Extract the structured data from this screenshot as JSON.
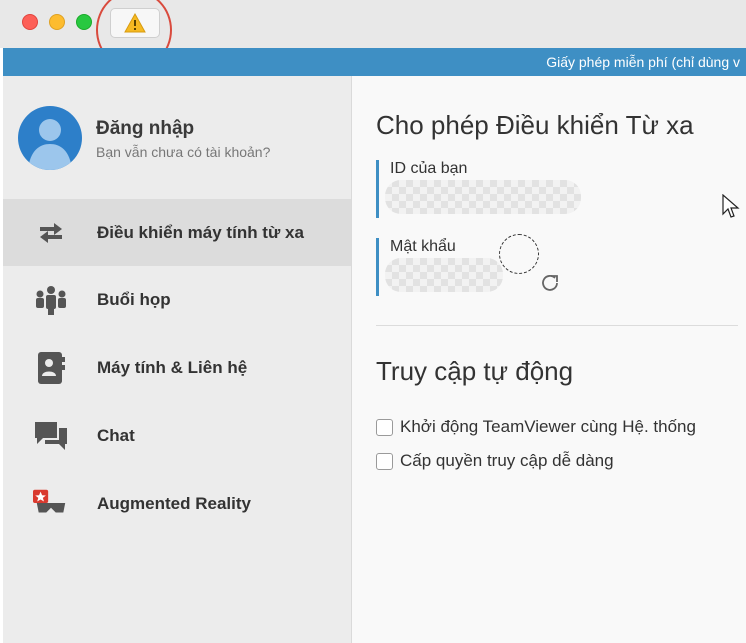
{
  "window": {
    "controls": [
      "close",
      "minimize",
      "zoom"
    ],
    "toolbar_icon": "warning-icon",
    "annotation_color": "#d94a3d"
  },
  "banner": {
    "text": "Giấy phép miễn phí (chỉ dùng v",
    "color": "#3e8fc4"
  },
  "account": {
    "name": "Đăng nhập",
    "subtitle": "Bạn vẫn chưa có tài khoản?",
    "icon": "user-avatar-icon"
  },
  "sidebar": {
    "items": [
      {
        "label": "Điều khiển máy tính từ xa",
        "icon": "remote-arrows-icon",
        "active": true
      },
      {
        "label": "Buổi họp",
        "icon": "meeting-icon",
        "active": false
      },
      {
        "label": "Máy tính & Liên hệ",
        "icon": "contacts-icon",
        "active": false
      },
      {
        "label": "Chat",
        "icon": "chat-icon",
        "active": false
      },
      {
        "label": "Augmented Reality",
        "icon": "augmented-reality-icon",
        "active": false
      }
    ]
  },
  "main": {
    "remote_title": "Cho phép Điều khiển Từ xa",
    "id_label": "ID của bạn",
    "password_label": "Mật khẩu",
    "auto_access_title": "Truy cập tự động",
    "options": [
      {
        "label": "Khởi động TeamViewer cùng Hệ. thống",
        "checked": false
      },
      {
        "label": "Cấp quyền truy cập dễ dàng",
        "checked": false
      }
    ]
  }
}
